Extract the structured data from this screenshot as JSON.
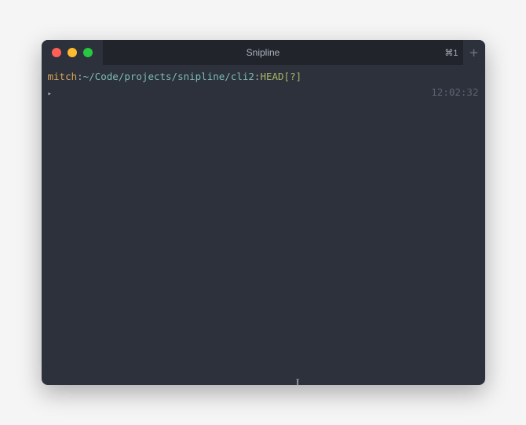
{
  "window": {
    "title": "Snipline",
    "shortcut": "⌘1",
    "new_tab_glyph": "+"
  },
  "prompt": {
    "user": "mitch",
    "sep1": ":",
    "path": "~/Code/projects/snipline/cli2",
    "sep2": ":",
    "git_ref": "HEAD[?]",
    "symbol": "▸"
  },
  "timestamp": "12:02:32",
  "cursor_glyph": "I"
}
